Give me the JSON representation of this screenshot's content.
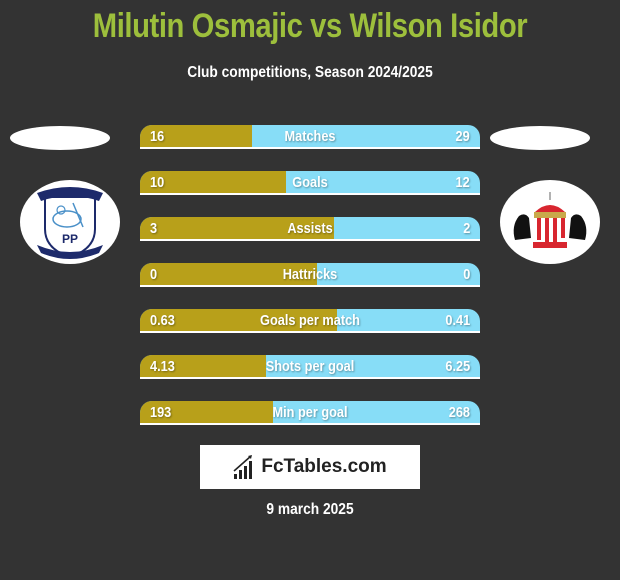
{
  "header": {
    "title": "Milutin Osmajic vs Wilson Isidor",
    "subtitle": "Club competitions, Season 2024/2025"
  },
  "players": {
    "left": {
      "name": "Milutin Osmajic",
      "club_crest": "preston-north-end-crest-icon"
    },
    "right": {
      "name": "Wilson Isidor",
      "club_crest": "sunderland-crest-icon"
    }
  },
  "colors": {
    "background": "#333333",
    "title": "#9dbf3c",
    "left_bar": "#b8a01a",
    "right_bar": "#87ddf7"
  },
  "stats": [
    {
      "label": "Matches",
      "left": "16",
      "right": "29",
      "left_share": 0.33
    },
    {
      "label": "Goals",
      "left": "10",
      "right": "12",
      "left_share": 0.43
    },
    {
      "label": "Assists",
      "left": "3",
      "right": "2",
      "left_share": 0.57
    },
    {
      "label": "Hattricks",
      "left": "0",
      "right": "0",
      "left_share": 0.52
    },
    {
      "label": "Goals per match",
      "left": "0.63",
      "right": "0.41",
      "left_share": 0.58
    },
    {
      "label": "Shots per goal",
      "left": "4.13",
      "right": "6.25",
      "left_share": 0.37
    },
    {
      "label": "Min per goal",
      "left": "193",
      "right": "268",
      "left_share": 0.39
    }
  ],
  "footer": {
    "logo_text": "FcTables.com",
    "logo_icon": "bar-chart-icon",
    "date": "9 march 2025"
  }
}
